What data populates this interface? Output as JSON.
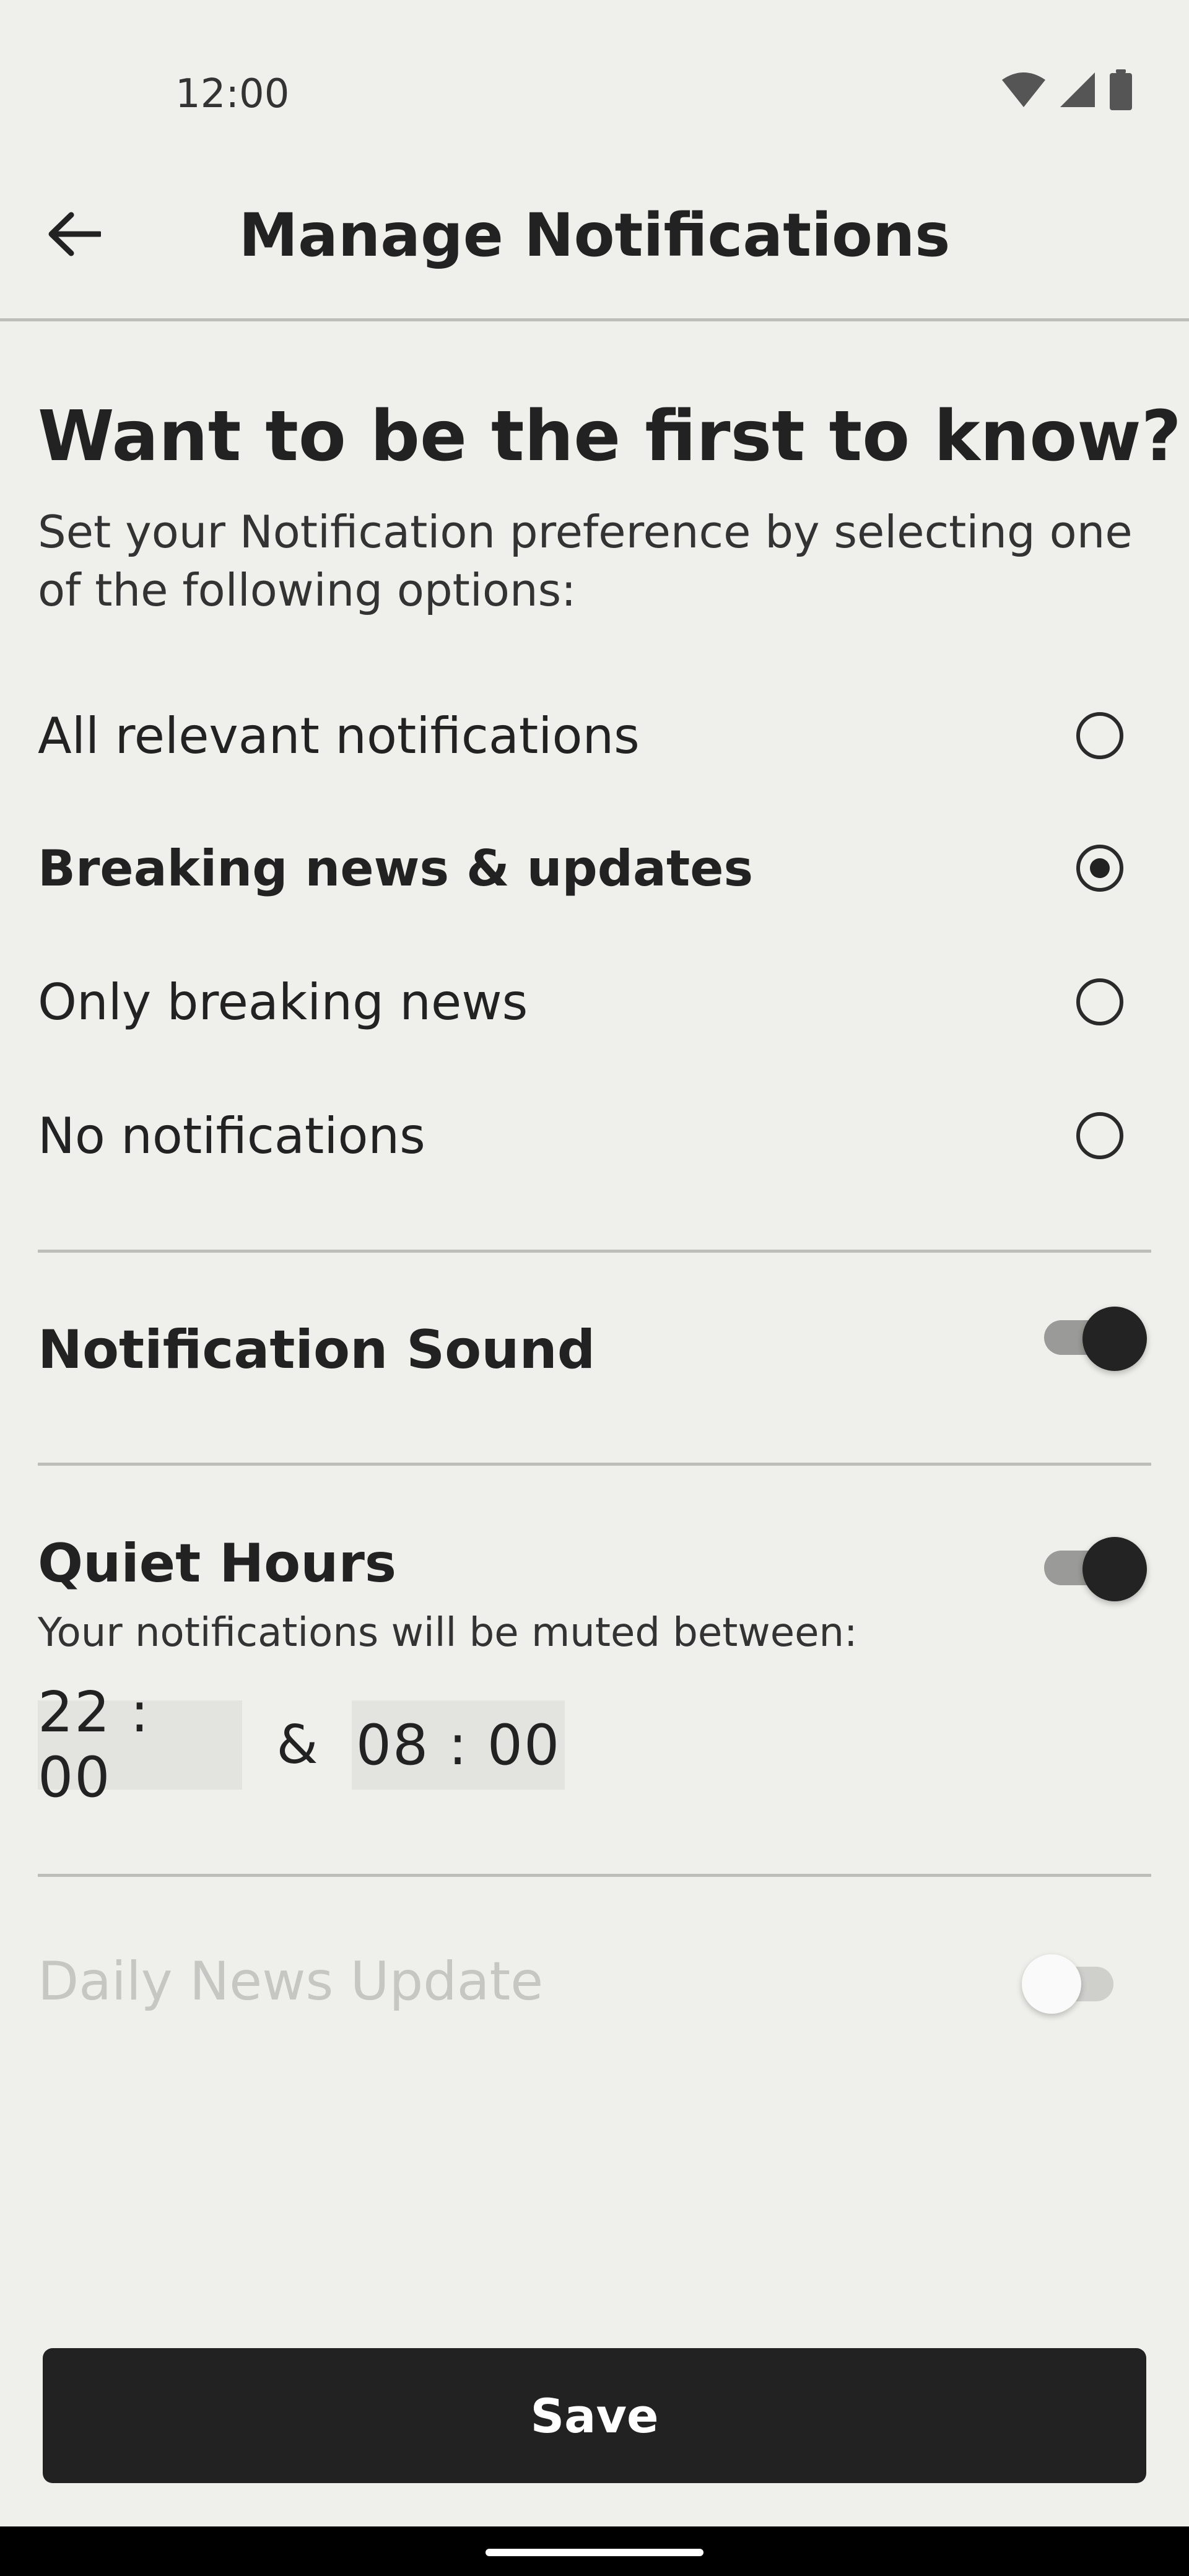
{
  "status_bar": {
    "time": "12:00",
    "icons": [
      "wifi-icon",
      "signal-icon",
      "battery-icon"
    ]
  },
  "header": {
    "title": "Manage Notifications",
    "back_icon": "arrow-left-icon"
  },
  "intro": {
    "headline": "Want to be the first to know?",
    "description": "Set your Notification preference by selecting one of the following options:"
  },
  "options": [
    {
      "label": "All relevant notifications",
      "selected": false
    },
    {
      "label": "Breaking news & updates",
      "selected": true
    },
    {
      "label": "Only breaking news",
      "selected": false
    },
    {
      "label": "No notifications",
      "selected": false
    }
  ],
  "notification_sound": {
    "label": "Notification Sound",
    "enabled": true
  },
  "quiet_hours": {
    "label": "Quiet Hours",
    "enabled": true,
    "description": "Your notifications will be muted between:",
    "start": "22 : 00",
    "separator": "&",
    "end": "08 : 00"
  },
  "daily_news_update": {
    "label": "Daily News Update",
    "enabled": false,
    "disabled": true
  },
  "save_label": "Save",
  "colors": {
    "background": "#efefeb",
    "primary_text": "#222222",
    "divider": "#bdbdba",
    "button_bg": "#222222",
    "disabled_text": "#c6c6c3"
  }
}
